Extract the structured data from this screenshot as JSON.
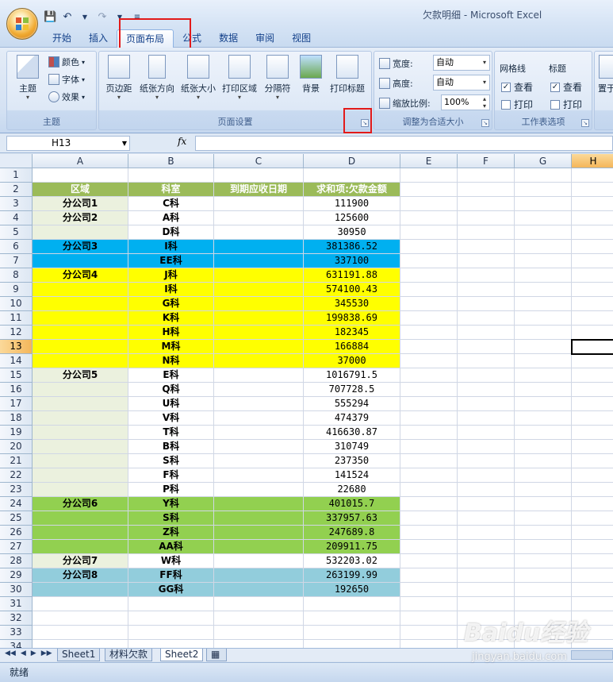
{
  "window": {
    "title": "欠款明细 - Microsoft Excel"
  },
  "tabs": [
    "开始",
    "插入",
    "页面布局",
    "公式",
    "数据",
    "审阅",
    "视图"
  ],
  "active_tab": "页面布局",
  "ribbon": {
    "theme_group": {
      "label": "主题",
      "big_button": "主题",
      "colors": "颜色",
      "fonts": "字体",
      "effects": "效果"
    },
    "page_setup_group": {
      "label": "页面设置",
      "buttons": [
        "页边距",
        "纸张方向",
        "纸张大小",
        "打印区域",
        "分隔符",
        "背景",
        "打印标题"
      ]
    },
    "scale_group": {
      "label": "调整为合适大小",
      "width_label": "宽度:",
      "width_value": "自动",
      "height_label": "高度:",
      "height_value": "自动",
      "scale_label": "缩放比例:",
      "scale_value": "100%"
    },
    "sheet_options_group": {
      "label": "工作表选项",
      "gridlines": "网格线",
      "headings": "标题",
      "view": "查看",
      "print": "打印",
      "gridlines_view": true,
      "gridlines_print": false,
      "headings_view": true,
      "headings_print": false
    },
    "next_group_partial": "置于"
  },
  "formula_bar": {
    "name_box": "H13",
    "fx": "fx",
    "formula": ""
  },
  "columns": [
    "A",
    "B",
    "C",
    "D",
    "E",
    "F",
    "G",
    "H"
  ],
  "selected_column": "H",
  "selected_row": 13,
  "header_row": [
    "区域",
    "科室",
    "到期应收日期",
    "求和项:欠款金额"
  ],
  "rows": [
    {
      "region": "分公司1",
      "dept": "C科",
      "amount": "111900",
      "fill": "#ebf1de"
    },
    {
      "region": "分公司2",
      "dept": "A科",
      "amount": "125600",
      "fill": "#ebf1de"
    },
    {
      "region": "",
      "dept": "D科",
      "amount": "30950",
      "fill": "#ebf1de"
    },
    {
      "region": "分公司3",
      "dept": "I科",
      "amount": "381386.52",
      "fill": "#00b0f0"
    },
    {
      "region": "",
      "dept": "EE科",
      "amount": "337100",
      "fill": "#00b0f0"
    },
    {
      "region": "分公司4",
      "dept": "J科",
      "amount": "631191.88",
      "fill": "#ffff00"
    },
    {
      "region": "",
      "dept": "I科",
      "amount": "574100.43",
      "fill": "#ffff00"
    },
    {
      "region": "",
      "dept": "G科",
      "amount": "345530",
      "fill": "#ffff00"
    },
    {
      "region": "",
      "dept": "K科",
      "amount": "199838.69",
      "fill": "#ffff00"
    },
    {
      "region": "",
      "dept": "H科",
      "amount": "182345",
      "fill": "#ffff00"
    },
    {
      "region": "",
      "dept": "M科",
      "amount": "166884",
      "fill": "#ffff00"
    },
    {
      "region": "",
      "dept": "N科",
      "amount": "37000",
      "fill": "#ffff00"
    },
    {
      "region": "分公司5",
      "dept": "E科",
      "amount": "1016791.5",
      "fill": "#ebf1de"
    },
    {
      "region": "",
      "dept": "Q科",
      "amount": "707728.5",
      "fill": "#ebf1de"
    },
    {
      "region": "",
      "dept": "U科",
      "amount": "555294",
      "fill": "#ebf1de"
    },
    {
      "region": "",
      "dept": "V科",
      "amount": "474379",
      "fill": "#ebf1de"
    },
    {
      "region": "",
      "dept": "T科",
      "amount": "416630.87",
      "fill": "#ebf1de"
    },
    {
      "region": "",
      "dept": "B科",
      "amount": "310749",
      "fill": "#ebf1de"
    },
    {
      "region": "",
      "dept": "S科",
      "amount": "237350",
      "fill": "#ebf1de"
    },
    {
      "region": "",
      "dept": "F科",
      "amount": "141524",
      "fill": "#ebf1de"
    },
    {
      "region": "",
      "dept": "P科",
      "amount": "22680",
      "fill": "#ebf1de"
    },
    {
      "region": "分公司6",
      "dept": "Y科",
      "amount": "401015.7",
      "fill": "#92d050"
    },
    {
      "region": "",
      "dept": "S科",
      "amount": "337957.63",
      "fill": "#92d050"
    },
    {
      "region": "",
      "dept": "Z科",
      "amount": "247689.8",
      "fill": "#92d050"
    },
    {
      "region": "",
      "dept": "AA科",
      "amount": "209911.75",
      "fill": "#92d050"
    },
    {
      "region": "分公司7",
      "dept": "W科",
      "amount": "532203.02",
      "fill": "#ebf1de"
    },
    {
      "region": "分公司8",
      "dept": "FF科",
      "amount": "263199.99",
      "fill": "#92cddc"
    },
    {
      "region": "",
      "dept": "GG科",
      "amount": "192650",
      "fill": "#92cddc"
    }
  ],
  "colors": {
    "header_fill": "#9bbb59",
    "highlight_box": "#e21a1a",
    "default_band": "#ebf1de"
  },
  "sheet_tabs": [
    "Sheet1",
    "材料欠款",
    "Sheet2"
  ],
  "active_sheet": "Sheet2",
  "status": "就绪",
  "watermark": {
    "brand": "Baidu经验",
    "url": "jingyan.baidu.com"
  }
}
